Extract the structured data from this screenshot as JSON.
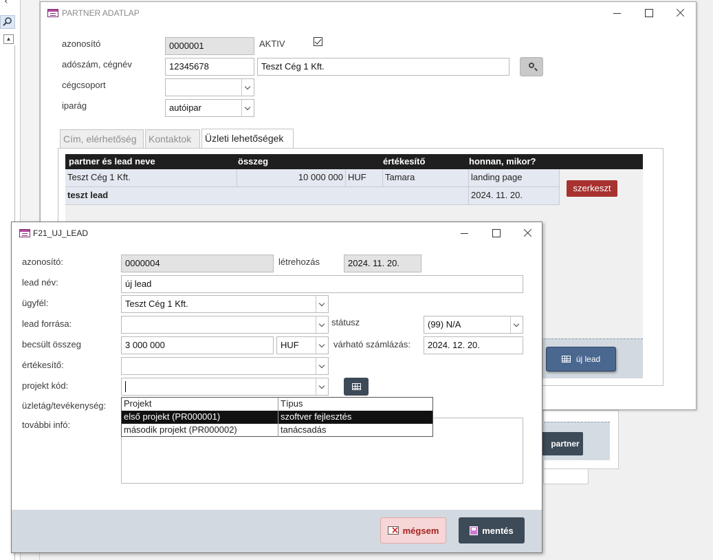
{
  "partner_window": {
    "title": "PARTNER ADATLAP",
    "fields": {
      "id_label": "azonosító",
      "id_value": "0000001",
      "active_label": "AKTIV",
      "active_checked": true,
      "tax_label": "adószám, cégnév",
      "tax_value": "12345678",
      "company_value": "Teszt Cég 1 Kft.",
      "group_label": "cégcsoport",
      "group_value": "",
      "industry_label": "iparág",
      "industry_value": "autóipar"
    },
    "tabs": [
      {
        "label": "Cím, elérhetőség",
        "active": false
      },
      {
        "label": "Kontaktok",
        "active": false
      },
      {
        "label": "Üzleti lehetőségek",
        "active": true
      }
    ],
    "opportunities": {
      "columns": [
        "partner és lead neve",
        "összeg",
        "értékesítő",
        "honnan, mikor?"
      ],
      "rows": [
        {
          "partner": "Teszt Cég 1 Kft.",
          "amount": "10 000 000",
          "currency": "HUF",
          "salesperson": "Tamara",
          "source": "landing page"
        },
        {
          "lead": "teszt lead",
          "date": "2024. 11. 20."
        }
      ],
      "edit_button": "szerkeszt",
      "new_lead_button": "új lead"
    }
  },
  "background_window": {
    "button": "partner"
  },
  "lead_window": {
    "title": "F21_UJ_LEAD",
    "fields": {
      "id_label": "azonosító:",
      "id_value": "0000004",
      "created_label": "létrehozás",
      "created_value": "2024. 11. 20.",
      "name_label": "lead név:",
      "name_value": "új lead",
      "client_label": "ügyfél:",
      "client_value": "Teszt Cég 1 Kft.",
      "source_label": "lead forrása:",
      "source_value": "",
      "status_label": "státusz",
      "status_value": "(99) N/A",
      "amount_label": "becsült összeg",
      "amount_value": "3 000 000",
      "currency_value": "HUF",
      "billing_label": "várható számlázás:",
      "billing_value": "2024. 12. 20.",
      "sales_label": "értékesítő:",
      "sales_value": "",
      "project_label": "projekt kód:",
      "project_value": "",
      "business_label": "üzletág/tevékenység:",
      "info_label": "további infó:",
      "info_value": ""
    },
    "project_dropdown": {
      "columns": [
        "Projekt",
        "Típus"
      ],
      "options": [
        {
          "project": "első projekt (PR000001)",
          "type": "szoftver fejlesztés",
          "selected": true
        },
        {
          "project": "második projekt (PR000002)",
          "type": "tanácsadás",
          "selected": false
        }
      ]
    },
    "buttons": {
      "cancel": "mégsem",
      "save": "mentés"
    }
  },
  "colors": {
    "header_dark": "#1f1f1f",
    "edit_red": "#a7322f",
    "new_lead_blue": "#4a6790",
    "save_dark": "#3d4a57",
    "cancel_pink": "#f6d6d6"
  }
}
